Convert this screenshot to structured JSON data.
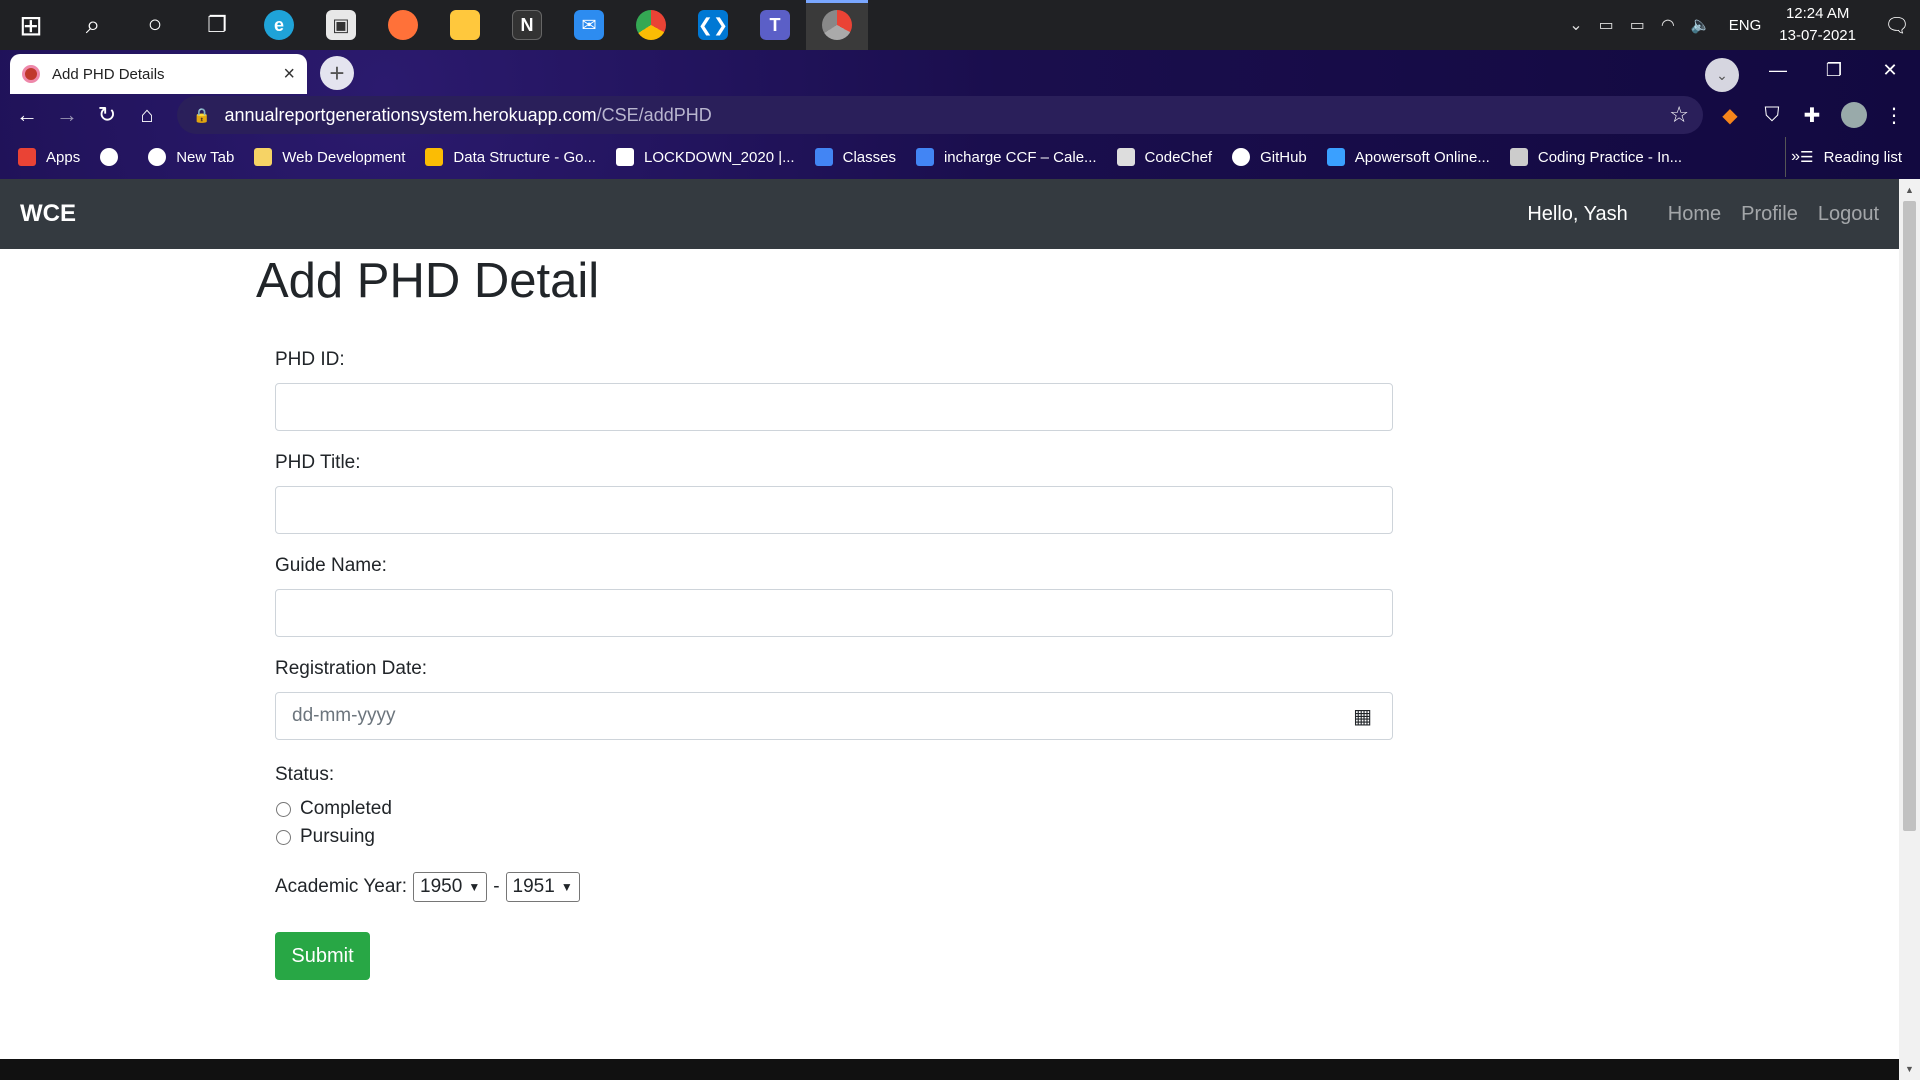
{
  "taskbar": {
    "apps": [
      {
        "name": "start-icon",
        "glyph": "⊞",
        "color": "#ffffff"
      },
      {
        "name": "search-icon",
        "glyph": "⌕",
        "color": "#ffffff"
      },
      {
        "name": "cortana-icon",
        "glyph": "○",
        "color": "#ffffff"
      },
      {
        "name": "task-view-icon",
        "glyph": "❐",
        "color": "#ffffff"
      },
      {
        "name": "edge-icon",
        "glyph": "e",
        "color": "#1fa3d8"
      },
      {
        "name": "store-icon",
        "glyph": "▣",
        "color": "#f0f0f0"
      },
      {
        "name": "firefox-icon",
        "glyph": "●",
        "color": "#ff7139"
      },
      {
        "name": "file-explorer-icon",
        "glyph": "▬",
        "color": "#ffc83d"
      },
      {
        "name": "notion-icon",
        "glyph": "N",
        "color": "#333333"
      },
      {
        "name": "mail-icon",
        "glyph": "✉",
        "color": "#2d8cf0"
      },
      {
        "name": "chrome-icon",
        "glyph": "◉",
        "color": "#34a853"
      },
      {
        "name": "vscode-icon",
        "glyph": "❮❯",
        "color": "#0078d4"
      },
      {
        "name": "teams-icon",
        "glyph": "T",
        "color": "#5b5fc7"
      },
      {
        "name": "chrome-profile-icon",
        "glyph": "◉",
        "color": "#db4437"
      }
    ],
    "language": "ENG",
    "time": "12:24 AM",
    "date": "13-07-2021"
  },
  "browser": {
    "tab_title": "Add PHD Details",
    "url_host": "annualreportgenerationsystem.herokuapp.com",
    "url_path": "/CSE/addPHD",
    "bookmarks": [
      {
        "label": "Apps",
        "icon": "apps-grid-icon",
        "color": "#ea4335"
      },
      {
        "label": "",
        "icon": "globe-icon",
        "color": "#ffffff"
      },
      {
        "label": "New Tab",
        "icon": "globe-icon",
        "color": "#ffffff"
      },
      {
        "label": "Web Development",
        "icon": "folder-icon",
        "color": "#f6d365"
      },
      {
        "label": "Data Structure - Go...",
        "icon": "drive-icon",
        "color": "#fbbc04"
      },
      {
        "label": "LOCKDOWN_2020 |...",
        "icon": "trello-icon",
        "color": "#ffffff"
      },
      {
        "label": "Classes",
        "icon": "classroom-icon",
        "color": "#4285f4"
      },
      {
        "label": "incharge CCF – Cale...",
        "icon": "calendar-icon",
        "color": "#4285f4"
      },
      {
        "label": "CodeChef",
        "icon": "codechef-icon",
        "color": "#dddddd"
      },
      {
        "label": "GitHub",
        "icon": "github-icon",
        "color": "#ffffff"
      },
      {
        "label": "Apowersoft Online...",
        "icon": "apowersoft-icon",
        "color": "#3aa0ff"
      },
      {
        "label": "Coding Practice - In...",
        "icon": "mountain-icon",
        "color": "#cccccc"
      }
    ],
    "reading_list": "Reading list"
  },
  "app": {
    "brand": "WCE",
    "greeting": "Hello, Yash",
    "nav_links": [
      "Home",
      "Profile",
      "Logout"
    ]
  },
  "form": {
    "heading": "Add PHD Detail",
    "fields": {
      "phd_id_label": "PHD ID:",
      "phd_id_value": "",
      "phd_title_label": "PHD Title:",
      "phd_title_value": "",
      "guide_name_label": "Guide Name:",
      "guide_name_value": "",
      "registration_date_label": "Registration Date:",
      "registration_date_placeholder": "dd-mm-yyyy"
    },
    "status_label": "Status:",
    "status_options": [
      "Completed",
      "Pursuing"
    ],
    "academic_year_label": "Academic Year:",
    "year_from": "1950",
    "year_separator": "-",
    "year_to": "1951",
    "submit_label": "Submit"
  },
  "colors": {
    "navbar": "#343a40",
    "submit": "#28a745",
    "chrome_frame": "#1a0e4d"
  }
}
